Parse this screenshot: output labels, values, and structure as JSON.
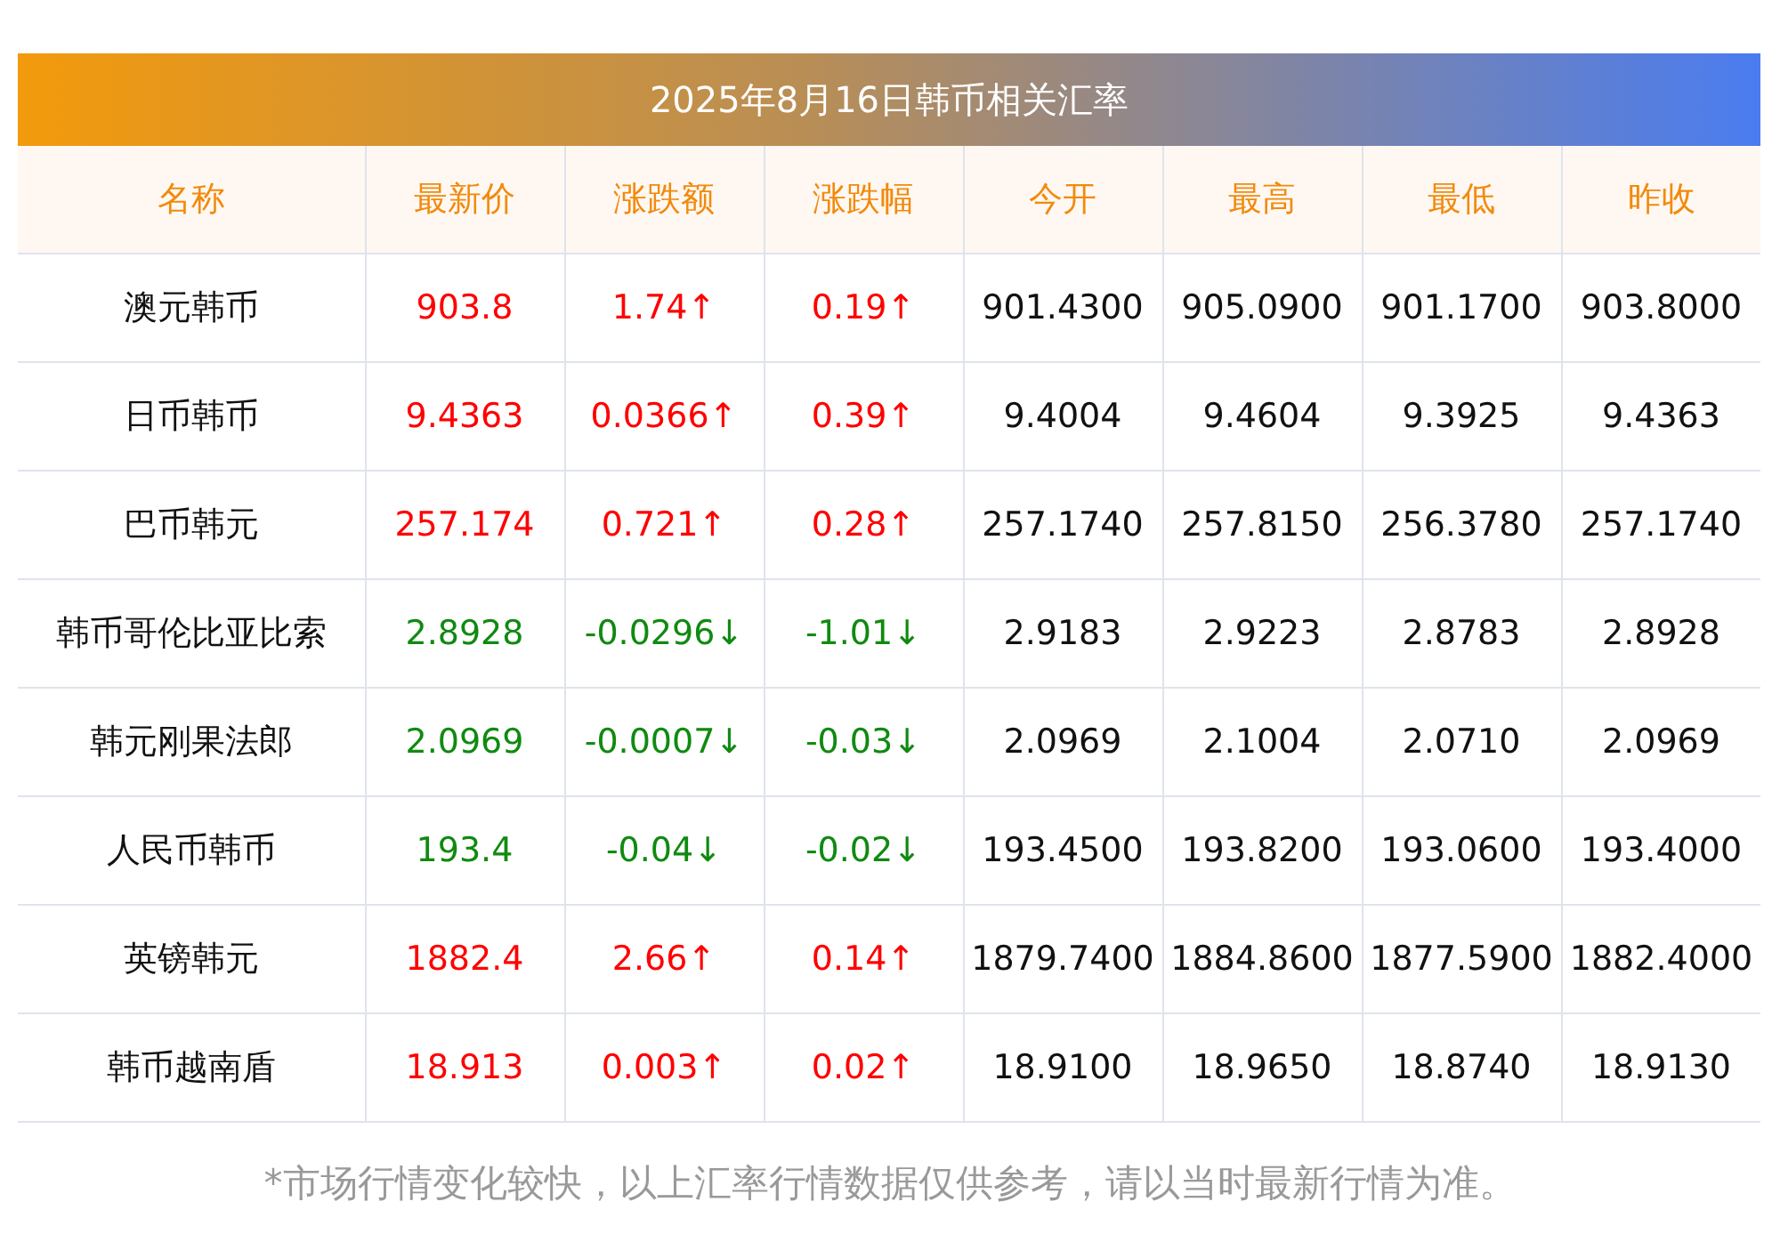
{
  "title": "2025年8月16日韩币相关汇率",
  "columns": [
    "名称",
    "最新价",
    "涨跌额",
    "涨跌幅",
    "今开",
    "最高",
    "最低",
    "昨收"
  ],
  "rows": [
    {
      "name": "澳元韩币",
      "price": "903.8",
      "change": "1.74↑",
      "percent": "0.19↑",
      "open": "901.4300",
      "high": "905.0900",
      "low": "901.1700",
      "prev_close": "903.8000",
      "color": "#ff0000"
    },
    {
      "name": "日币韩币",
      "price": "9.4363",
      "change": "0.0366↑",
      "percent": "0.39↑",
      "open": "9.4004",
      "high": "9.4604",
      "low": "9.3925",
      "prev_close": "9.4363",
      "color": "#ff0000"
    },
    {
      "name": "巴币韩元",
      "price": "257.174",
      "change": "0.721↑",
      "percent": "0.28↑",
      "open": "257.1740",
      "high": "257.8150",
      "low": "256.3780",
      "prev_close": "257.1740",
      "color": "#ff0000"
    },
    {
      "name": "韩币哥伦比亚比索",
      "price": "2.8928",
      "change": "-0.0296↓",
      "percent": "-1.01↓",
      "open": "2.9183",
      "high": "2.9223",
      "low": "2.8783",
      "prev_close": "2.8928",
      "color": "#108a10"
    },
    {
      "name": "韩元刚果法郎",
      "price": "2.0969",
      "change": "-0.0007↓",
      "percent": "-0.03↓",
      "open": "2.0969",
      "high": "2.1004",
      "low": "2.0710",
      "prev_close": "2.0969",
      "color": "#108a10"
    },
    {
      "name": "人民币韩币",
      "price": "193.4",
      "change": "-0.04↓",
      "percent": "-0.02↓",
      "open": "193.4500",
      "high": "193.8200",
      "low": "193.0600",
      "prev_close": "193.4000",
      "color": "#108a10"
    },
    {
      "name": "英镑韩元",
      "price": "1882.4",
      "change": "2.66↑",
      "percent": "0.14↑",
      "open": "1879.7400",
      "high": "1884.8600",
      "low": "1877.5900",
      "prev_close": "1882.4000",
      "color": "#ff0000"
    },
    {
      "name": "韩币越南盾",
      "price": "18.913",
      "change": "0.003↑",
      "percent": "0.02↑",
      "open": "18.9100",
      "high": "18.9650",
      "low": "18.8740",
      "prev_close": "18.9130",
      "color": "#ff0000"
    }
  ],
  "footnote": "*市场行情变化较快，以上汇率行情数据仅供参考，请以当时最新行情为准。"
}
